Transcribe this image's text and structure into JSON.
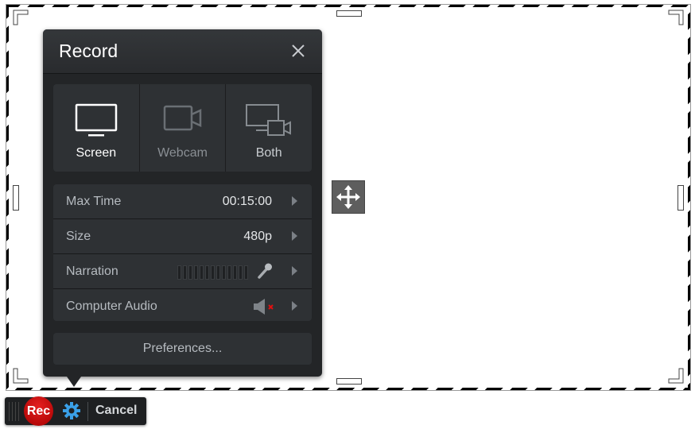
{
  "panel": {
    "title": "Record",
    "close_icon": "close-icon",
    "modes": [
      {
        "label": "Screen",
        "icon": "monitor-icon",
        "state": "active"
      },
      {
        "label": "Webcam",
        "icon": "webcam-icon",
        "state": "dim"
      },
      {
        "label": "Both",
        "icon": "screen-and-webcam-icon",
        "state": "normal"
      }
    ],
    "settings": [
      {
        "label": "Max Time",
        "value": "00:15:00"
      },
      {
        "label": "Size",
        "value": "480p"
      },
      {
        "label": "Narration",
        "value": "",
        "icon": "microphone-icon"
      },
      {
        "label": "Computer Audio",
        "value": "",
        "icon": "speaker-muted-icon"
      }
    ],
    "preferences_label": "Preferences..."
  },
  "toolbar": {
    "rec_label": "Rec",
    "gear_icon": "gear-icon",
    "cancel_label": "Cancel"
  },
  "colors": {
    "panel_bg": "#232527",
    "rec_red": "#d61010",
    "gear_blue": "#3aa0e8",
    "muted_x": "#e01010"
  }
}
